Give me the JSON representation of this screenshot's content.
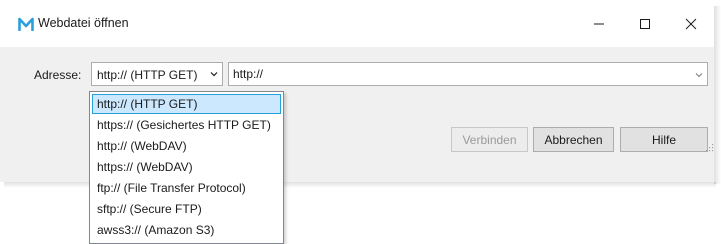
{
  "window": {
    "title": "Webdatei öffnen",
    "app_icon": "m-logo-icon",
    "controls": [
      "minimize-icon",
      "maximize-icon",
      "close-icon"
    ]
  },
  "form": {
    "address_label": "Adresse:",
    "protocol_selected": "http:// (HTTP GET)",
    "url_value": "http://"
  },
  "protocol_options": [
    "http:// (HTTP GET)",
    "https:// (Gesichertes HTTP GET)",
    "http:// (WebDAV)",
    "https:// (WebDAV)",
    "ftp:// (File Transfer Protocol)",
    "sftp:// (Secure FTP)",
    "awss3:// (Amazon S3)"
  ],
  "buttons": {
    "connect": "Verbinden",
    "cancel": "Abbrechen",
    "help": "Hilfe"
  },
  "colors": {
    "accent": "#2b9fd9",
    "selection_bg": "#cce8ff",
    "selection_border": "#26a0da"
  }
}
